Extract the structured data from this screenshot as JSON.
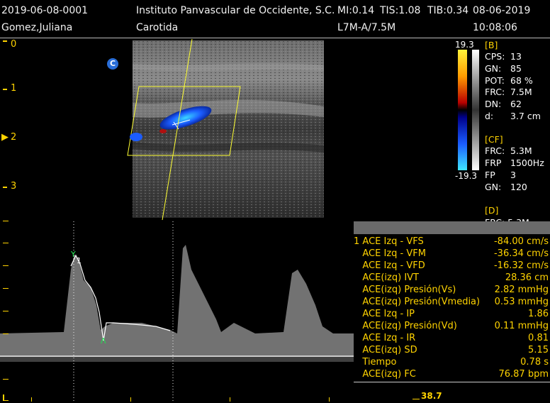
{
  "header": {
    "exam_id": "2019-06-08-0001",
    "institute": "Instituto Panvascular de Occidente, S.C.",
    "mi": "MI:0.14",
    "tis": "TIS:1.08",
    "tib": "TIB:0.34",
    "date": "08-06-2019",
    "patient": "Gomez,Juliana",
    "study": "Carotida",
    "probe": "L7M-A/7.5M",
    "time": "10:08:06"
  },
  "depth_scale": [
    "0",
    "1",
    "2",
    "3"
  ],
  "depth_marker": "▶",
  "color_mode_badge": "C",
  "color_scale": {
    "top": "19.3",
    "bottom": "-19.3"
  },
  "params": {
    "b_header": "[B]",
    "b": [
      {
        "k": "CPS:",
        "v": "13"
      },
      {
        "k": "GN:",
        "v": "85"
      },
      {
        "k": "POT:",
        "v": "68 %"
      },
      {
        "k": "FRC:",
        "v": "7.5M"
      },
      {
        "k": "DN:",
        "v": "62"
      },
      {
        "k": "d:",
        "v": "3.7 cm"
      }
    ],
    "cf_header": "[CF]",
    "cf": [
      {
        "k": "FRC:",
        "v": "5.3M"
      },
      {
        "k": "FRP",
        "v": "1500Hz"
      },
      {
        "k": "FP",
        "v": "3"
      },
      {
        "k": "GN:",
        "v": "120"
      }
    ],
    "d_header": "[D]",
    "d_partial": "FRC: 5.3M"
  },
  "measurements": [
    {
      "label": "1 ACE Izq - VFS",
      "value": "-84.00 cm/s"
    },
    {
      "label": "   ACE Izq - VFM",
      "value": "-36.34 cm/s"
    },
    {
      "label": "   ACE Izq - VFD",
      "value": "-16.32 cm/s"
    },
    {
      "label": "   ACE(izq) IVT",
      "value": "28.36 cm"
    },
    {
      "label": "   ACE(izq) Presión(Vs)",
      "value": "2.82 mmHg"
    },
    {
      "label": "   ACE(izq) Presión(Vmedia)",
      "value": "0.53 mmHg"
    },
    {
      "label": "   ACE Izq - IP",
      "value": "1.86"
    },
    {
      "label": "   ACE(izq) Presión(Vd)",
      "value": "0.11 mmHg"
    },
    {
      "label": "   ACE Izq - IR",
      "value": "0.81"
    },
    {
      "label": "   ACE(izq) SD",
      "value": "5.15"
    },
    {
      "label": "   Tiempo",
      "value": "0.78 s"
    },
    {
      "label": "   ACE(izq) FC",
      "value": "76.87 bpm"
    }
  ],
  "markers": {
    "caliper_index": "1",
    "caliper_top": "Y",
    "caliper_bottom": "Λ"
  },
  "velocity_scale": "38.7",
  "colors": {
    "accent_yellow": "#ffd300",
    "header_text": "#f2f2f2",
    "flow_blue": "#1e5cff",
    "flow_cyan": "#19c9ff",
    "flow_red": "#d21010"
  }
}
